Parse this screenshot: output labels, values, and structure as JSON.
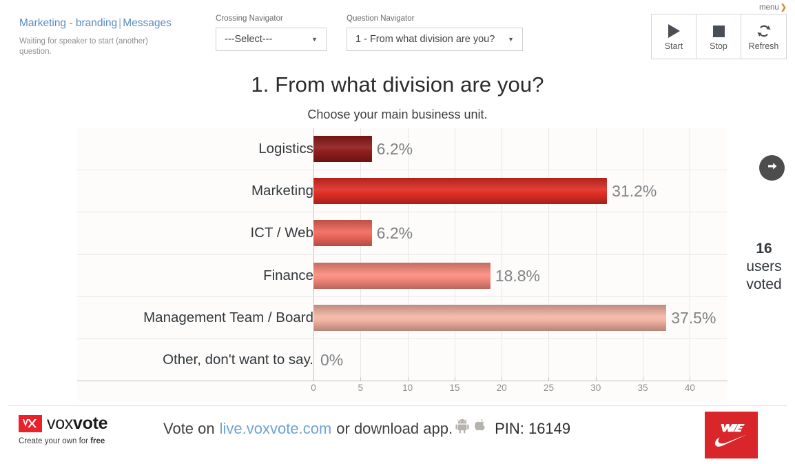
{
  "header": {
    "session_name": "Marketing - branding",
    "separator": "|",
    "messages_link": "Messages",
    "status": "Waiting for speaker to start (another) question.",
    "menu_label": "menu",
    "menu_chevron": "❯",
    "crossing_navigator": {
      "label": "Crossing Navigator",
      "value": "---Select---",
      "arrow": "▼"
    },
    "question_navigator": {
      "label": "Question Navigator",
      "value": "1 - From what division are you?",
      "arrow": "▼"
    },
    "controls": [
      {
        "label": "Start",
        "icon": "play-icon"
      },
      {
        "label": "Stop",
        "icon": "stop-icon"
      },
      {
        "label": "Refresh",
        "icon": "refresh-icon"
      }
    ]
  },
  "question": {
    "title": "1. From what division are you?",
    "subtitle": "Choose your main business unit."
  },
  "chart_data": {
    "type": "bar",
    "orientation": "horizontal",
    "title": "1. From what division are you?",
    "subtitle": "Choose your main business unit.",
    "xlabel": "",
    "ylabel": "",
    "xlim": [
      0,
      44
    ],
    "xticks": [
      0,
      5,
      10,
      15,
      20,
      25,
      30,
      35,
      40
    ],
    "grid": true,
    "legend": false,
    "categories": [
      "Logistics",
      "Marketing",
      "ICT / Web",
      "Finance",
      "Management Team / Board",
      "Other, don't want to say."
    ],
    "values": [
      6.2,
      31.2,
      6.2,
      18.8,
      37.5,
      0
    ],
    "value_labels": [
      "6.2%",
      "31.2%",
      "6.2%",
      "18.8%",
      "37.5%",
      "0%"
    ],
    "bar_colors": [
      "#8f1a1a",
      "#e02b22",
      "#f0675a",
      "#fa8a7c",
      "#f4b4a3",
      "#f4b4a3"
    ]
  },
  "rail": {
    "next_icon": "arrow-right-icon",
    "voted_count": "16",
    "voted_line1": "users",
    "voted_line2": "voted"
  },
  "footer": {
    "brand_word_light": "vox",
    "brand_word_bold": "vote",
    "brand_mark": "voxvote-logo-icon",
    "tagline_prefix": "Create your own for ",
    "tagline_bold": "free",
    "vote_on": "Vote on",
    "vote_url": "live.voxvote.com",
    "download_text": "or download app.",
    "android_icon": "android-icon",
    "apple_icon": "apple-icon",
    "pin": "PIN: 16149",
    "sponsor_logo": "nike-logo-icon"
  },
  "colors": {
    "link": "#5a8bbd",
    "accent_red": "#e02b22",
    "brand_red": "#d8262b",
    "panel_bg": "#fdfcfa"
  }
}
